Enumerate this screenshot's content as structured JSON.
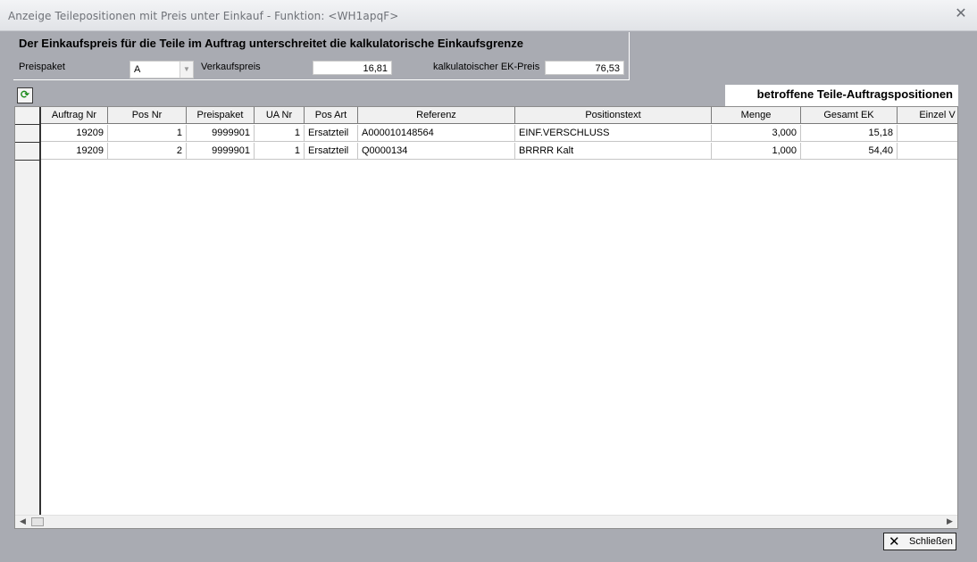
{
  "window": {
    "title": "Anzeige Teilepositionen mit Preis unter Einkauf - Funktion: <WH1apqF>",
    "close_glyph": "✕"
  },
  "header": {
    "heading": "Der Einkaufspreis für die Teile im Auftrag unterschreitet die kalkulatorische Einkaufsgrenze",
    "preispaket_label": "Preispaket",
    "preispaket_value": "A",
    "verkaufspreis_label": "Verkaufspreis",
    "verkaufspreis_value": "16,81",
    "ek_preis_label": "kalkulatoischer EK-Preis",
    "ek_preis_value": "76,53"
  },
  "grid": {
    "section_label": "betroffene Teile-Auftragspositionen",
    "columns": [
      "Auftrag Nr",
      "Pos Nr",
      "Preispaket",
      "UA Nr",
      "Pos Art",
      "Referenz",
      "Positionstext",
      "Menge",
      "Gesamt EK",
      "Einzel V"
    ],
    "rows": [
      [
        "19209",
        "1",
        "9999901",
        "1",
        "Ersatzteil",
        "A000010148564",
        "EINF.VERSCHLUSS",
        "3,000",
        "15,18",
        ""
      ],
      [
        "19209",
        "2",
        "9999901",
        "1",
        "Ersatzteil",
        "Q0000134",
        "BRRRR Kalt",
        "1,000",
        "54,40",
        ""
      ]
    ]
  },
  "footer": {
    "close_label": "Schließen"
  },
  "icons": {
    "refresh": "refresh-icon",
    "dropdown": "chevron-down-icon",
    "close": "close-icon"
  }
}
